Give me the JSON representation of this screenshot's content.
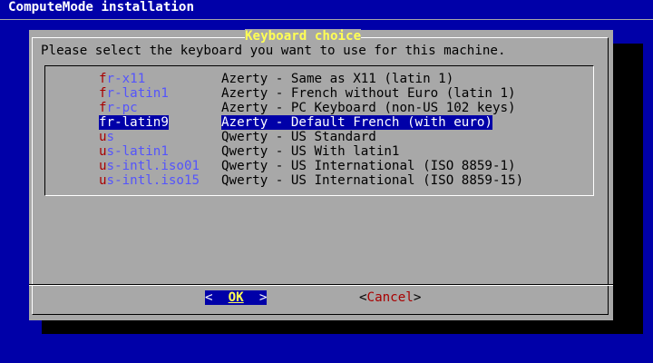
{
  "window": {
    "title": "ComputeMode installation"
  },
  "dialog": {
    "title": "Keyboard choice",
    "prompt": "Please select the keyboard you want to use for this machine.",
    "items": [
      {
        "hot": "f",
        "rest": "r-x11",
        "desc": "Azerty - Same as X11 (latin 1)",
        "selected": false
      },
      {
        "hot": "f",
        "rest": "r-latin1",
        "desc": "Azerty - French without Euro (latin 1)",
        "selected": false
      },
      {
        "hot": "f",
        "rest": "r-pc",
        "desc": "Azerty - PC Keyboard (non-US 102 keys)",
        "selected": false
      },
      {
        "hot": "f",
        "rest": "r-latin9",
        "desc": "Azerty - Default French (with euro)",
        "selected": true
      },
      {
        "hot": "u",
        "rest": "s",
        "desc": "Qwerty - US Standard",
        "selected": false
      },
      {
        "hot": "u",
        "rest": "s-latin1",
        "desc": "Qwerty - US With latin1",
        "selected": false
      },
      {
        "hot": "u",
        "rest": "s-intl.iso01",
        "desc": "Qwerty - US International (ISO 8859-1)",
        "selected": false
      },
      {
        "hot": "u",
        "rest": "s-intl.iso15",
        "desc": "Qwerty - US International (ISO 8859-15)",
        "selected": false
      }
    ],
    "buttons": {
      "ok": {
        "left": "<",
        "label": "OK",
        "right": ">"
      },
      "cancel": {
        "left": "<",
        "hot": "C",
        "rest": "ancel",
        "right": ">"
      }
    }
  },
  "colors": {
    "desktop_blue": "#0000a8",
    "dialog_gray": "#a8a8a8",
    "title_yellow": "#ffff54",
    "hotkey_red": "#a80000",
    "tag_blue": "#5454fc"
  }
}
